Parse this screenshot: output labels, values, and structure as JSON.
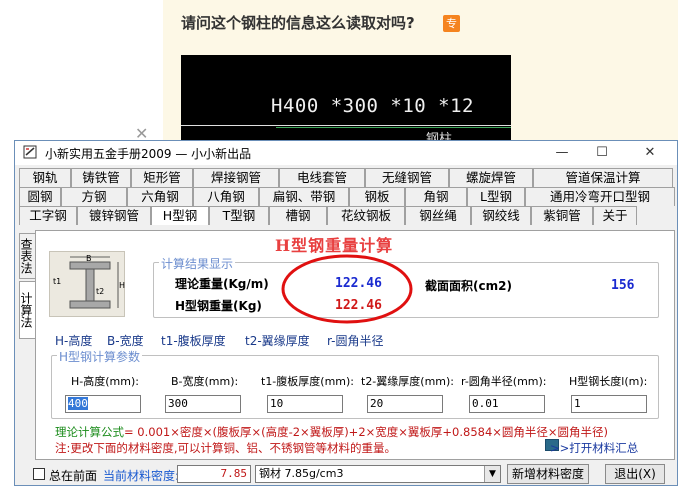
{
  "webpage": {
    "question": "请问这个钢柱的信息这么读取对吗?",
    "badge": "专",
    "cad_label": "H400 *300 *10 *12",
    "cad_sublabel": "钢柱"
  },
  "window": {
    "title": "小新实用五金手册2009 — 小小新出品",
    "controls": {
      "minimize": "—",
      "maximize": "☐",
      "close": "✕"
    }
  },
  "tabs": {
    "row1": [
      "钢轨",
      "铸铁管",
      "矩形管",
      "焊接钢管",
      "电线套管",
      "无缝钢管",
      "螺旋焊管",
      "管道保温计算"
    ],
    "row2": [
      "圆钢",
      "方钢",
      "六角钢",
      "八角钢",
      "扁钢、带钢",
      "钢板",
      "角钢",
      "L型钢",
      "通用冷弯开口型钢"
    ],
    "row3": [
      "工字钢",
      "镀锌钢管",
      "H型钢",
      "T型钢",
      "槽钢",
      "花纹钢板",
      "钢丝绳",
      "钢绞线",
      "紫铜管",
      "关于"
    ]
  },
  "side_tabs": {
    "lookup": "查表法",
    "calc": "计算法"
  },
  "diagram_labels": {
    "b": "B",
    "h": "H",
    "t1": "t1",
    "t2": "t2"
  },
  "heading": "H型钢重量计算",
  "results": {
    "group_title": "计算结果显示",
    "theory_label": "理论重量(Kg/m)",
    "theory_value": "122.46",
    "weight_label": "H型钢重量(Kg)",
    "weight_value": "122.46",
    "area_label": "截面面积(cm2)",
    "area_value": "156"
  },
  "legend": [
    "H-高度",
    "B-宽度",
    "t1-腹板厚度",
    "t2-翼缘厚度",
    "r-圆角半径"
  ],
  "params": {
    "group_title": "H型钢计算参数",
    "fields": [
      {
        "label": "H-高度(mm):",
        "value": "400"
      },
      {
        "label": "B-宽度(mm):",
        "value": "300"
      },
      {
        "label": "t1-腹板厚度(mm):",
        "value": "10"
      },
      {
        "label": "t2-翼缘厚度(mm):",
        "value": "20"
      },
      {
        "label": "r-圆角半径(mm):",
        "value": "0.01"
      },
      {
        "label": "H型钢长度l(m):",
        "value": "1"
      }
    ]
  },
  "formula": {
    "label": "理论计算公式",
    "text": "= 0.001×密度×(腹板厚×(高度-2×翼板厚)+2×宽度×翼板厚+0.8584×圆角半径×圆角半径)"
  },
  "note": "注:更改下面的材料密度,可以计算铜、铝、不锈钢管等材料的重量。",
  "summary_link": ">>打开材料汇总",
  "bottom": {
    "stay_on_top": "总在前面",
    "density_label": "当前材料密度:",
    "density_value": "7.85",
    "material": "钢材 7.85g/cm3",
    "new_material_button": "新增材料密度",
    "exit_button": "退出(X)"
  },
  "colors": {
    "accent_blue": "#6c8ecf",
    "result_blue": "#1a2ad0",
    "result_red": "#d01818",
    "heading_red": "#e84040",
    "annotation_red": "#e01010"
  }
}
